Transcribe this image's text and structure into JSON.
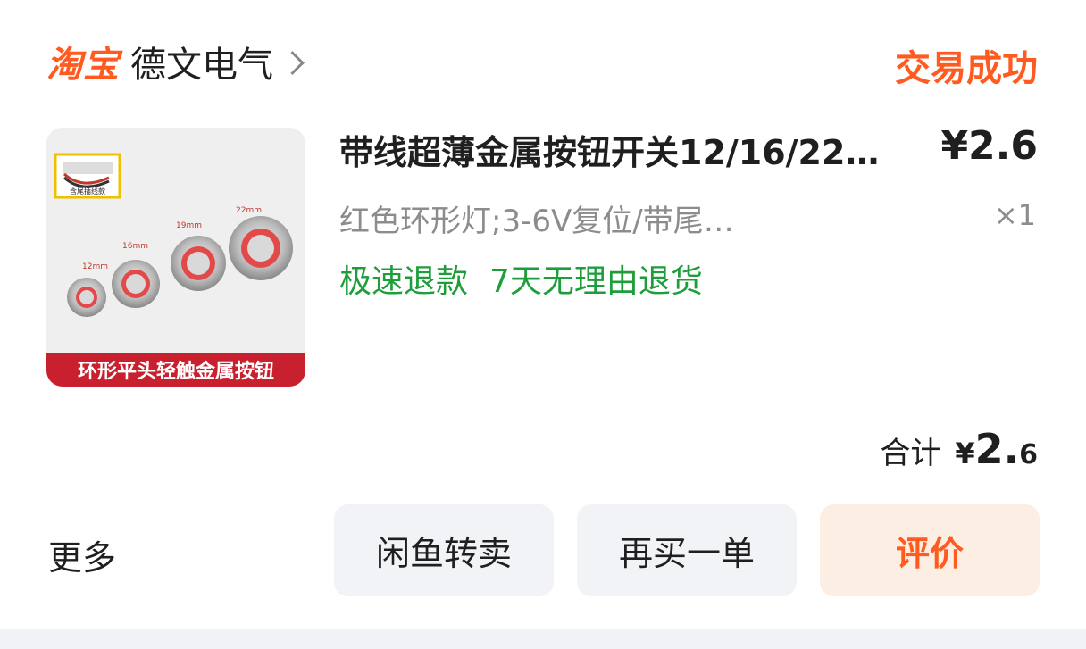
{
  "shop": {
    "platform_logo": "淘宝",
    "name": "德文电气",
    "chevron_icon": "chevron-right-icon"
  },
  "order": {
    "status": "交易成功",
    "status_color": "#ff5a1f"
  },
  "item": {
    "image": {
      "tag": "含尾插线款",
      "sizes": [
        "12mm",
        "16mm",
        "19mm",
        "22mm"
      ],
      "banner": "环形平头轻触金属按钮"
    },
    "title": "带线超薄金属按钮开关12/16/22…",
    "price": "¥2.6",
    "spec": "红色环形灯;3-6V复位/带尾…",
    "quantity": "×1",
    "tags": [
      "极速退款",
      "7天无理由退货"
    ],
    "tag_color": "#1e9e3b"
  },
  "summary": {
    "label": "合计",
    "currency": "¥",
    "amount_int": "2.",
    "amount_dec": "6"
  },
  "actions": {
    "more": "更多",
    "resell": "闲鱼转卖",
    "reorder": "再买一单",
    "review": "评价"
  }
}
